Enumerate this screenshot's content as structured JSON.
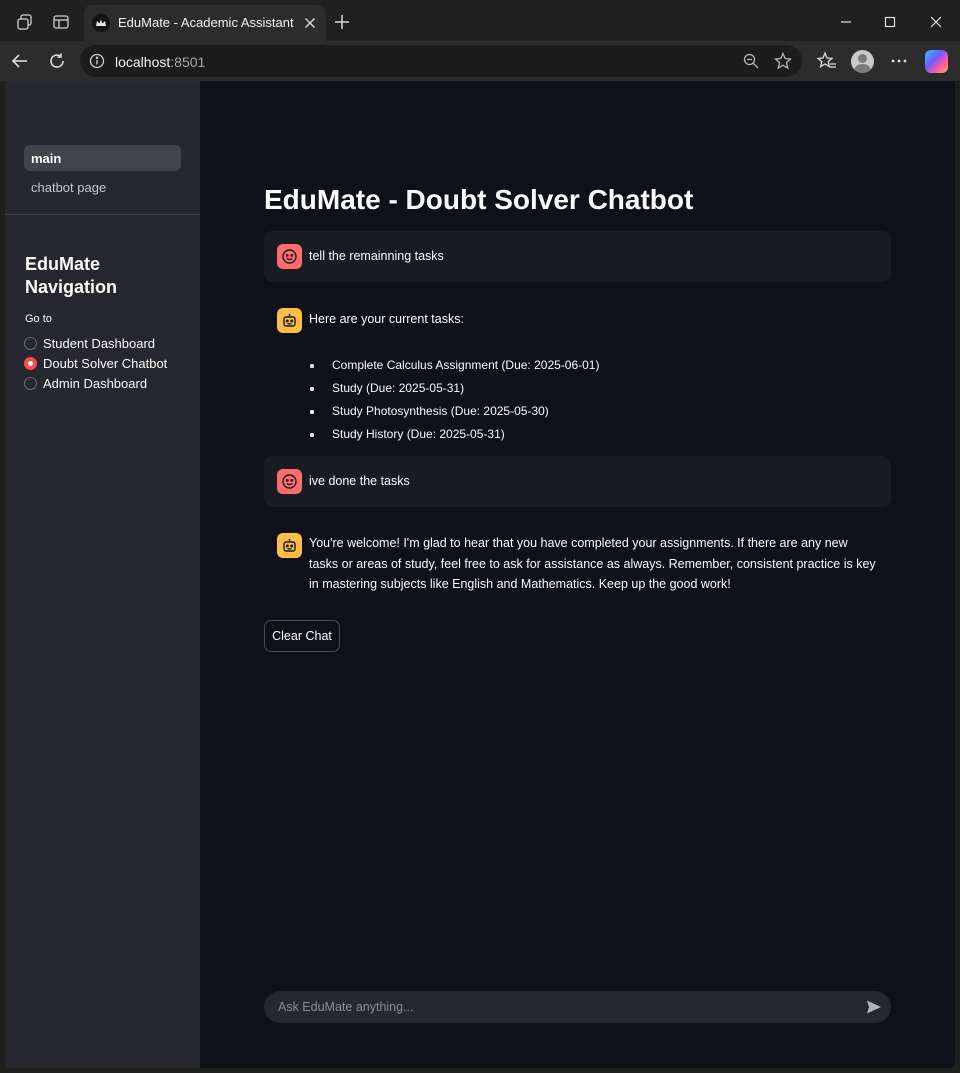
{
  "browser": {
    "tab_title": "EduMate - Academic Assistant",
    "url_host": "localhost",
    "url_port": ":8501"
  },
  "sidebar": {
    "pages": [
      {
        "label": "main",
        "active": true
      },
      {
        "label": "chatbot page",
        "active": false
      }
    ],
    "title": "EduMate Navigation",
    "goto_label": "Go to",
    "options": [
      {
        "label": "Student Dashboard",
        "selected": false
      },
      {
        "label": "Doubt Solver Chatbot",
        "selected": true
      },
      {
        "label": "Admin Dashboard",
        "selected": false
      }
    ]
  },
  "main": {
    "title": "EduMate - Doubt Solver Chatbot",
    "messages": [
      {
        "role": "user",
        "text": "tell the remainning tasks"
      },
      {
        "role": "assistant",
        "text": "Here are your current tasks:",
        "items": [
          "Complete Calculus Assignment (Due: 2025-06-01)",
          "Study (Due: 2025-05-31)",
          "Study Photosynthesis (Due: 2025-05-30)",
          "Study History (Due: 2025-05-31)"
        ]
      },
      {
        "role": "user",
        "text": "ive done the tasks"
      },
      {
        "role": "assistant",
        "text": "You're welcome! I'm glad to hear that you have completed your assignments. If there are any new tasks or areas of study, feel free to ask for assistance as always. Remember, consistent practice is key in mastering subjects like English and Mathematics. Keep up the good work!"
      }
    ],
    "clear_button": "Clear Chat",
    "chat_placeholder": "Ask EduMate anything..."
  },
  "colors": {
    "accent": "#ff4b4b",
    "user_avatar": "#ff6c6c",
    "bot_avatar": "#ffbd45",
    "app_background": "#0e1117",
    "sidebar_background": "#262730"
  }
}
